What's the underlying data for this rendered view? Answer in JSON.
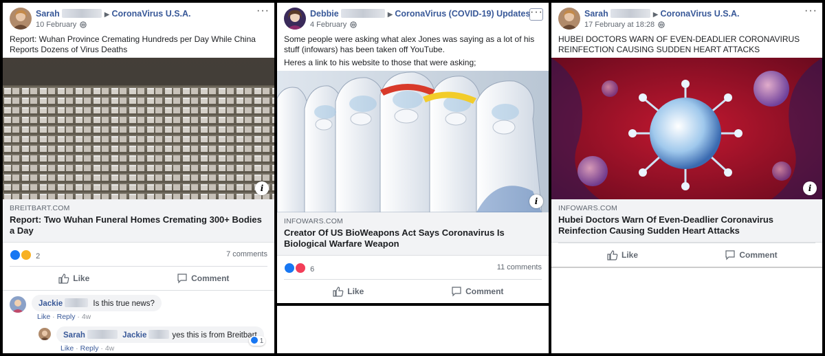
{
  "posts": [
    {
      "author": "Sarah",
      "group": "CoronaVirus U.S.A.",
      "date": "10 February",
      "text": [
        "Report: Wuhan Province Cremating Hundreds per Day While China Reports Dozens of Virus Deaths"
      ],
      "link": {
        "domain": "BREITBART.COM",
        "headline": "Report: Two Wuhan Funeral Homes Cremating 300+ Bodies a Day"
      },
      "reaction_count": "2",
      "comments_label": "7 comments",
      "like_label": "Like",
      "comment_label": "Comment",
      "comments": [
        {
          "author": "Jackie",
          "text": "Is this true news?",
          "like": "Like",
          "reply": "Reply",
          "time": "4w"
        }
      ],
      "replies": [
        {
          "author": "Sarah",
          "mention": "Jackie",
          "text": "yes this is from Breitbart",
          "like": "Like",
          "reply": "Reply",
          "time": "4w",
          "reaction_count": "1"
        }
      ]
    },
    {
      "author": "Debbie",
      "group": "CoronaVirus (COVID-19) Updates",
      "date": "4 February",
      "text": [
        "Some people were asking what alex Jones was saying as a lot of his stuff (infowars) has been taken off YouTube.",
        "Heres a link to his website to those that were asking;"
      ],
      "link": {
        "domain": "INFOWARS.COM",
        "headline": "Creator Of US BioWeapons Act Says Coronavirus Is Biological Warfare Weapon"
      },
      "reaction_count": "6",
      "comments_label": "11 comments",
      "like_label": "Like",
      "comment_label": "Comment"
    },
    {
      "author": "Sarah",
      "group": "CoronaVirus U.S.A.",
      "date": "17 February at 18:28",
      "text": [
        "HUBEI DOCTORS WARN OF EVEN-DEADLIER CORONAVIRUS REINFECTION CAUSING SUDDEN HEART ATTACKS"
      ],
      "link": {
        "domain": "INFOWARS.COM",
        "headline": "Hubei Doctors Warn Of Even-Deadlier Coronavirus Reinfection Causing Sudden Heart Attacks"
      },
      "like_label": "Like",
      "comment_label": "Comment"
    }
  ],
  "colors": {
    "link_blue": "#385898",
    "like_blue": "#1877f2",
    "love_red": "#f33e58",
    "wow_yellow": "#f7b125"
  },
  "icons": [
    "globe-icon",
    "more-options-icon",
    "info-icon",
    "like-icon",
    "comment-icon",
    "like-reaction-icon",
    "love-reaction-icon",
    "wow-reaction-icon"
  ]
}
